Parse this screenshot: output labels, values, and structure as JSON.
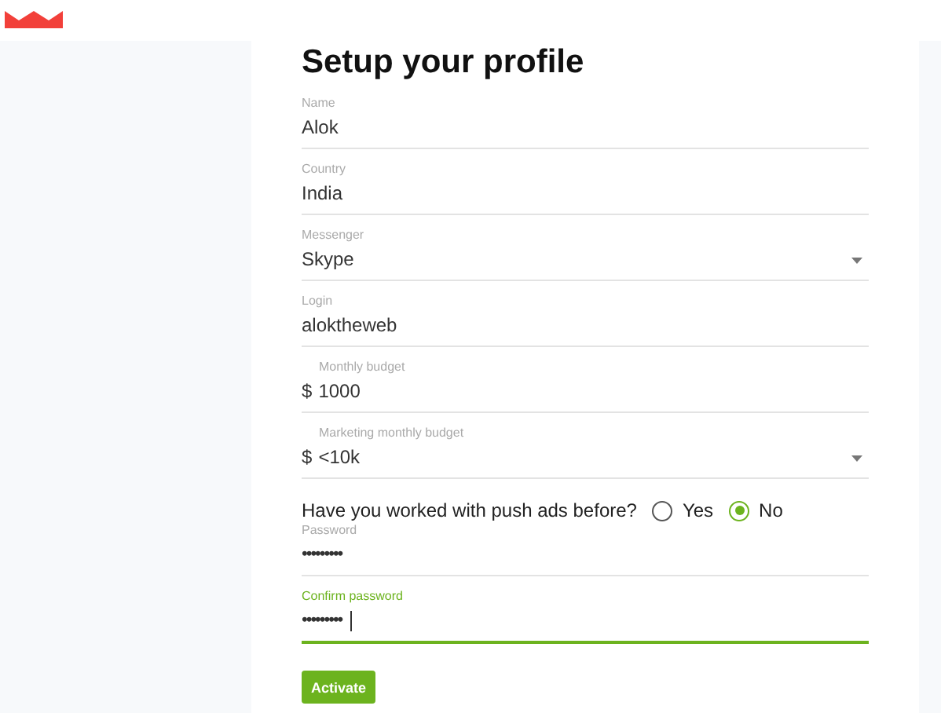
{
  "title": "Setup your profile",
  "fields": [
    {
      "kind": "text",
      "label": "Name",
      "value": "Alok",
      "focused": false
    },
    {
      "kind": "text",
      "label": "Country",
      "value": "India",
      "focused": false
    },
    {
      "kind": "select",
      "label": "Messenger",
      "value": "Skype",
      "focused": false
    },
    {
      "kind": "text",
      "label": "Login",
      "value": "aloktheweb",
      "focused": false
    },
    {
      "kind": "money",
      "label": "Monthly budget",
      "prefix": "$",
      "value": "1000",
      "focused": false
    },
    {
      "kind": "money-select",
      "label": "Marketing monthly budget",
      "prefix": "$",
      "value": "<10k",
      "focused": false
    }
  ],
  "question": {
    "text": "Have you worked with push ads before?",
    "options": [
      {
        "label": "Yes",
        "selected": false
      },
      {
        "label": "No",
        "selected": true
      }
    ]
  },
  "passwords": [
    {
      "kind": "password",
      "label": "Password",
      "value": "•••••••••",
      "focused": false
    },
    {
      "kind": "password",
      "label": "Confirm password",
      "value": "•••••••••",
      "focused": true
    }
  ],
  "button": "Activate"
}
